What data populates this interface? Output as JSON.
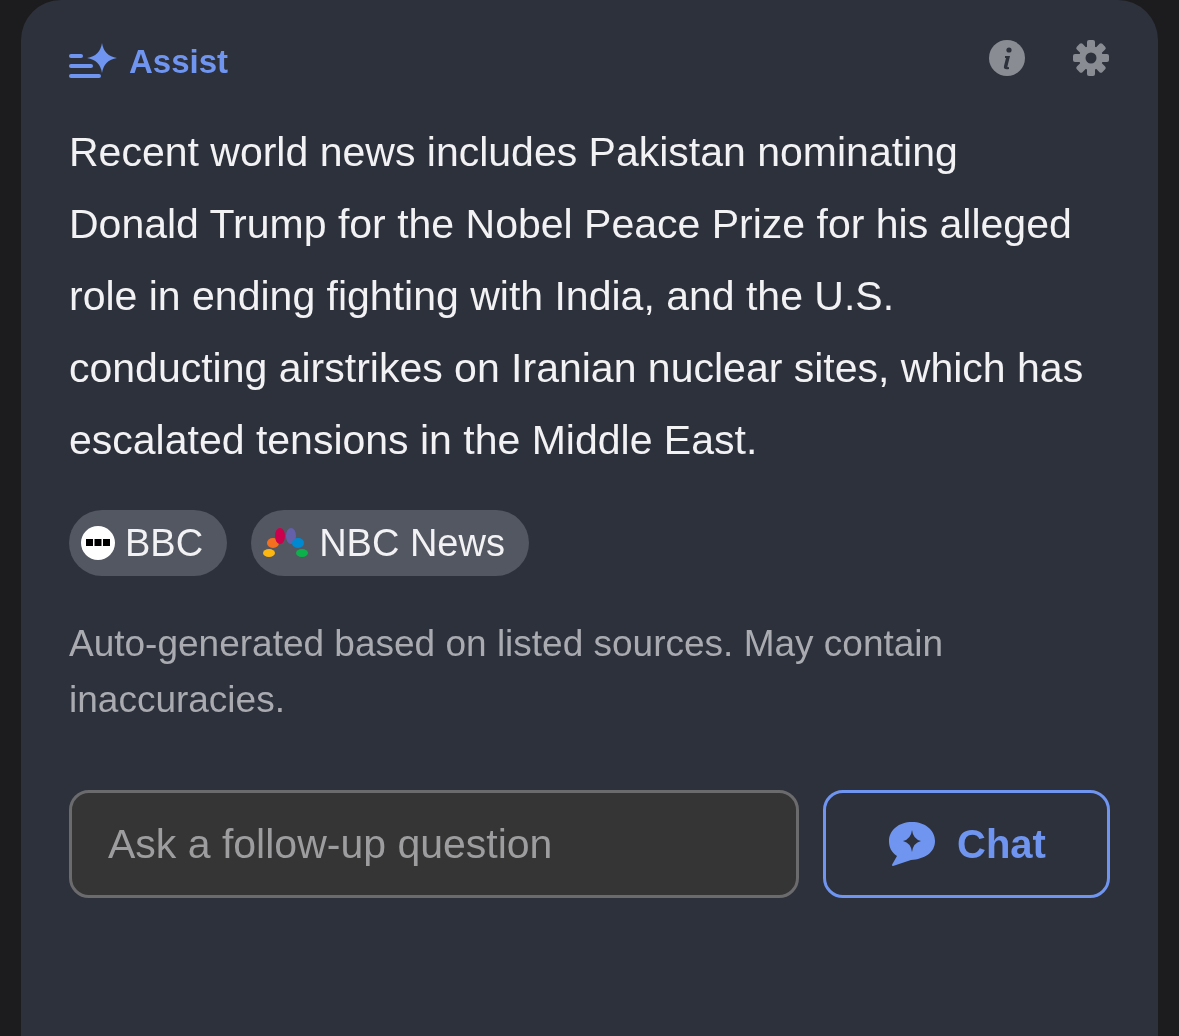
{
  "header": {
    "title": "Assist"
  },
  "summary": "Recent world news includes Pakistan nominating Donald Trump for the Nobel Peace Prize for his alleged role in ending fighting with India, and the U.S. conducting airstrikes on Iranian nuclear sites, which has escalated tensions in the Middle East.",
  "sources": [
    {
      "label": "BBC",
      "kind": "dots"
    },
    {
      "label": "NBC News",
      "kind": "peacock"
    }
  ],
  "disclaimer": "Auto-generated based on listed sources. May contain inaccuracies.",
  "followup": {
    "placeholder": "Ask a follow-up question"
  },
  "chat_button": {
    "label": "Chat"
  }
}
